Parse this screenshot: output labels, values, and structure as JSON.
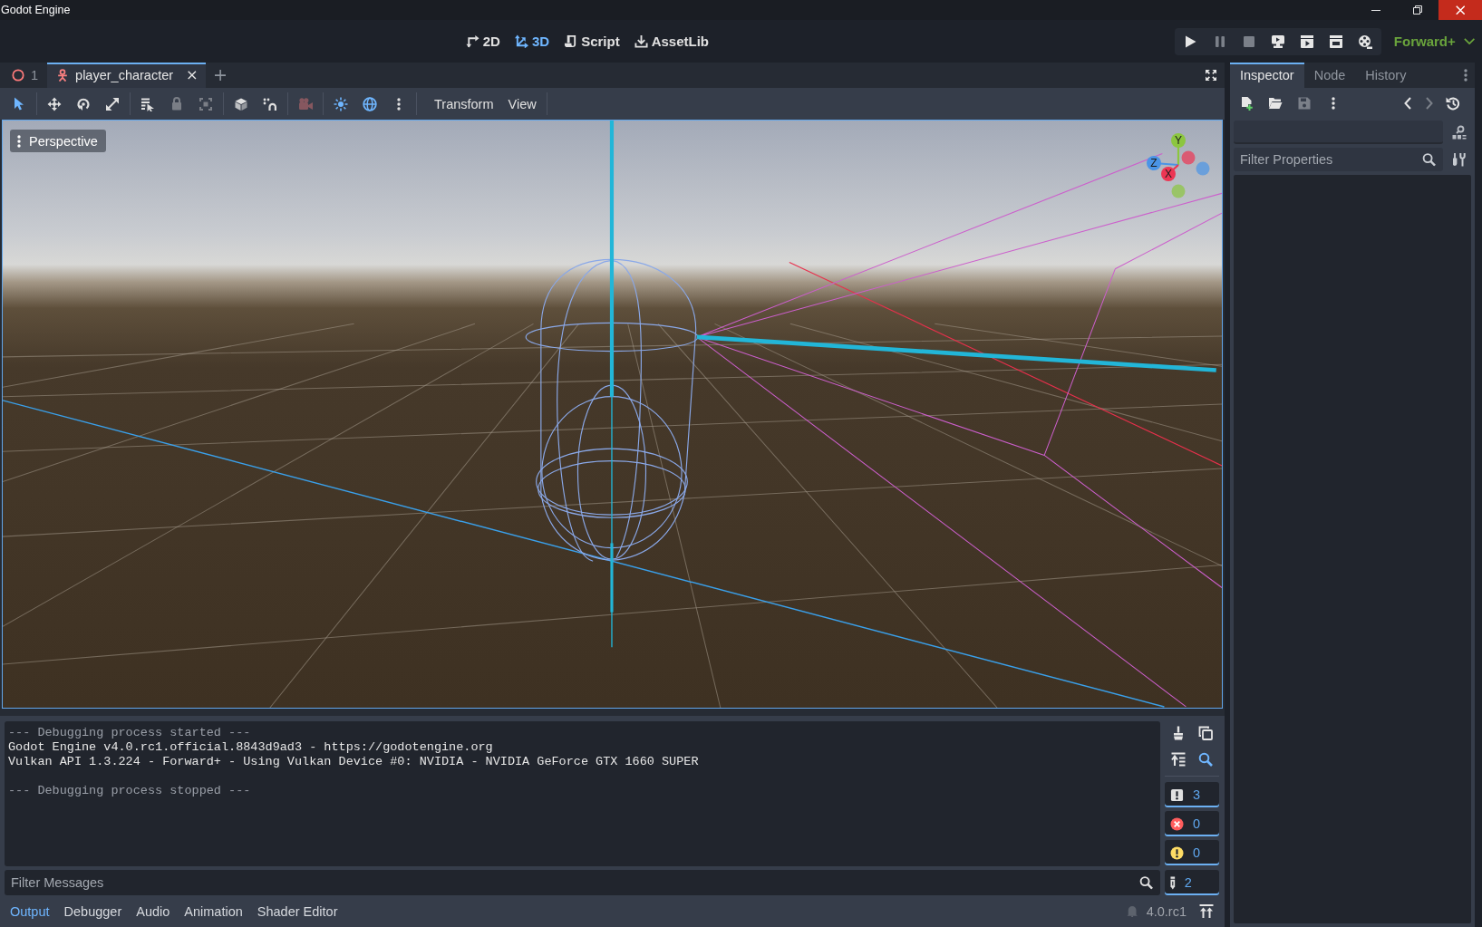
{
  "window": {
    "title": "Godot Engine"
  },
  "main_screens": [
    {
      "kind": "canvas",
      "label": "2D",
      "selected": false
    },
    {
      "kind": "spatial",
      "label": "3D",
      "selected": true
    },
    {
      "kind": "script",
      "label": "Script",
      "selected": false
    },
    {
      "kind": "assetlib",
      "label": "AssetLib",
      "selected": false
    }
  ],
  "run_bar": [
    {
      "kind": "play",
      "disabled": false
    },
    {
      "kind": "pause",
      "disabled": true
    },
    {
      "kind": "stop",
      "disabled": true
    },
    {
      "kind": "remote",
      "disabled": false
    },
    {
      "kind": "play-scene",
      "disabled": false
    },
    {
      "kind": "play-custom",
      "disabled": false
    },
    {
      "kind": "movie",
      "disabled": false
    }
  ],
  "renderer": {
    "label": "Forward+"
  },
  "scene_tabs": [
    {
      "kind": "ring",
      "label": "1",
      "selected": false,
      "closable": false
    },
    {
      "kind": "character",
      "label": "player_character",
      "selected": true,
      "closable": true
    }
  ],
  "viewport_toolbar": {
    "tool_groups": [
      [
        {
          "kind": "select",
          "selected": true,
          "disabled": false
        }
      ],
      [
        {
          "kind": "move",
          "selected": false,
          "disabled": false
        },
        {
          "kind": "rotate",
          "selected": false,
          "disabled": false
        },
        {
          "kind": "scale",
          "selected": false,
          "disabled": false
        }
      ],
      [
        {
          "kind": "list-select",
          "selected": false,
          "disabled": false
        },
        {
          "kind": "lock",
          "selected": false,
          "disabled": true
        },
        {
          "kind": "group",
          "selected": false,
          "disabled": true
        }
      ],
      [
        {
          "kind": "local-space",
          "selected": false,
          "disabled": false
        },
        {
          "kind": "snap",
          "selected": false,
          "disabled": false
        }
      ],
      [
        {
          "kind": "camera-preview",
          "selected": false,
          "disabled": true
        }
      ],
      [
        {
          "kind": "sun",
          "selected": true,
          "disabled": false
        },
        {
          "kind": "environment",
          "selected": true,
          "disabled": false
        },
        {
          "kind": "more",
          "selected": false,
          "disabled": false
        }
      ]
    ],
    "menus": [
      "Transform",
      "View"
    ]
  },
  "viewport": {
    "view_menu": "Perspective",
    "gizmo": [
      {
        "label": "Y",
        "color": "#8cc63f"
      },
      {
        "label": "Z",
        "color": "#4a94e6"
      },
      {
        "label": "X",
        "color": "#ec3553"
      }
    ]
  },
  "inspector": {
    "tabs": [
      {
        "label": "Inspector",
        "selected": true
      },
      {
        "label": "Node",
        "selected": false
      },
      {
        "label": "History",
        "selected": false
      }
    ],
    "toolbar": [
      {
        "kind": "new-resource",
        "disabled": false
      },
      {
        "kind": "open",
        "disabled": false
      },
      {
        "kind": "save",
        "disabled": true
      },
      {
        "kind": "more",
        "disabled": false
      },
      {
        "kind": "back",
        "disabled": false
      },
      {
        "kind": "forward",
        "disabled": true
      },
      {
        "kind": "history",
        "disabled": false
      }
    ],
    "filter": {
      "placeholder": "Filter Properties"
    }
  },
  "output": {
    "lines": [
      {
        "kind": "meta",
        "text": "--- Debugging process started ---"
      },
      {
        "kind": "plain",
        "text": "Godot Engine v4.0.rc1.official.8843d9ad3 - https://godotengine.org"
      },
      {
        "kind": "plain",
        "text": "Vulkan API 1.3.224 - Forward+ - Using Vulkan Device #0: NVIDIA - NVIDIA GeForce GTX 1660 SUPER"
      },
      {
        "kind": "blank"
      },
      {
        "kind": "meta",
        "text": "--- Debugging process stopped ---"
      }
    ],
    "tools": [
      {
        "kind": "clear",
        "on": false
      },
      {
        "kind": "copy",
        "on": false
      },
      {
        "kind": "collapse",
        "on": false
      },
      {
        "kind": "search",
        "on": true
      }
    ],
    "counters": [
      {
        "kind": "messages",
        "count": "3",
        "on": true
      },
      {
        "kind": "errors",
        "count": "0",
        "on": true
      },
      {
        "kind": "warnings",
        "count": "0",
        "on": true
      },
      {
        "kind": "editor",
        "count": "2",
        "on": true
      }
    ],
    "filter": {
      "placeholder": "Filter Messages"
    }
  },
  "bottom_tabs": [
    {
      "label": "Output",
      "selected": true
    },
    {
      "label": "Debugger",
      "selected": false
    },
    {
      "label": "Audio",
      "selected": false
    },
    {
      "label": "Animation",
      "selected": false
    },
    {
      "label": "Shader Editor",
      "selected": false
    }
  ],
  "version": "4.0.rc1"
}
